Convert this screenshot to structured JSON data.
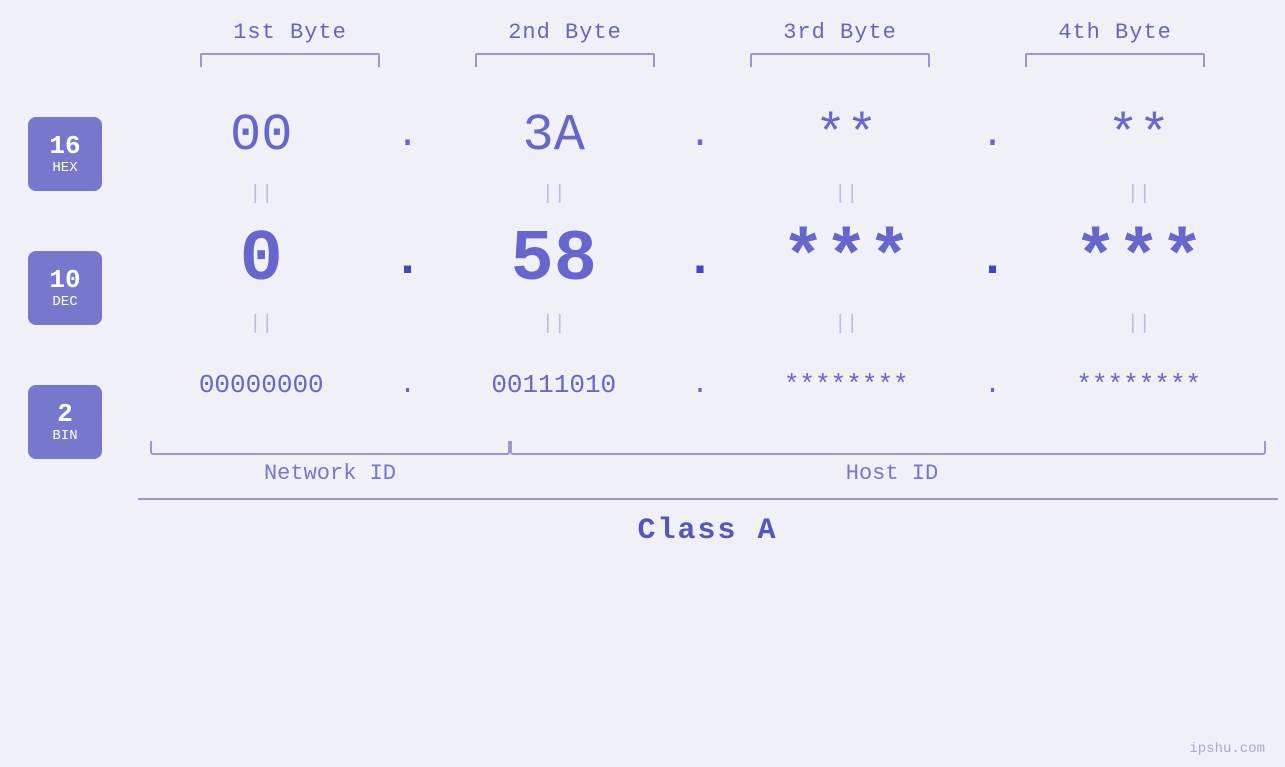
{
  "byteLabels": [
    "1st Byte",
    "2nd Byte",
    "3rd Byte",
    "4th Byte"
  ],
  "badges": [
    {
      "number": "16",
      "label": "HEX"
    },
    {
      "number": "10",
      "label": "DEC"
    },
    {
      "number": "2",
      "label": "BIN"
    }
  ],
  "hexValues": [
    "00",
    "3A",
    "**",
    "**"
  ],
  "decValues": [
    "0",
    "58",
    "***",
    "***"
  ],
  "binValues": [
    "00000000",
    "00111010",
    "********",
    "********"
  ],
  "dotSeparator": ".",
  "equalSign": "||",
  "networkIdLabel": "Network ID",
  "hostIdLabel": "Host ID",
  "classLabel": "Class A",
  "watermark": "ipshu.com"
}
